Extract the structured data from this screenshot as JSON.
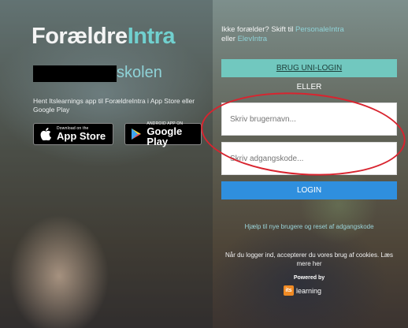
{
  "logo": {
    "part1": "Forældre",
    "part2": "Intra"
  },
  "school": {
    "suffix": "skolen"
  },
  "app_hint": "Hent Itslearnings app til ForældreIntra i App Store eller Google Play",
  "stores": {
    "app_store": {
      "small": "Download on the",
      "big": "App Store",
      "icon": "apple-icon"
    },
    "google_play": {
      "small": "ANDROID APP ON",
      "big": "Google Play",
      "icon": "play-icon"
    }
  },
  "switch": {
    "prefix": "Ikke forælder? Skift til",
    "link1": "PersonaleIntra",
    "middle": "eller",
    "link2": "ElevIntra"
  },
  "uni_login_button": "BRUG UNI-LOGIN",
  "or_text": "ELLER",
  "username": {
    "placeholder": "Skriv brugernavn..."
  },
  "password": {
    "placeholder": "Skriv adgangskode..."
  },
  "login_button": "LOGIN",
  "help_link": "Hjælp til nye brugere og reset af adgangskode",
  "cookies_text": "Når du logger ind, accepterer du vores brug af cookies. Læs mere her",
  "powered_by": "Powered by",
  "brand": {
    "mark": "its",
    "name": "learning"
  },
  "colors": {
    "accent_teal": "#71d0cf",
    "uni_button": "#71c8bf",
    "login_button": "#2f8fde",
    "annotation": "#d8242f",
    "brand_orange": "#f08a24"
  }
}
